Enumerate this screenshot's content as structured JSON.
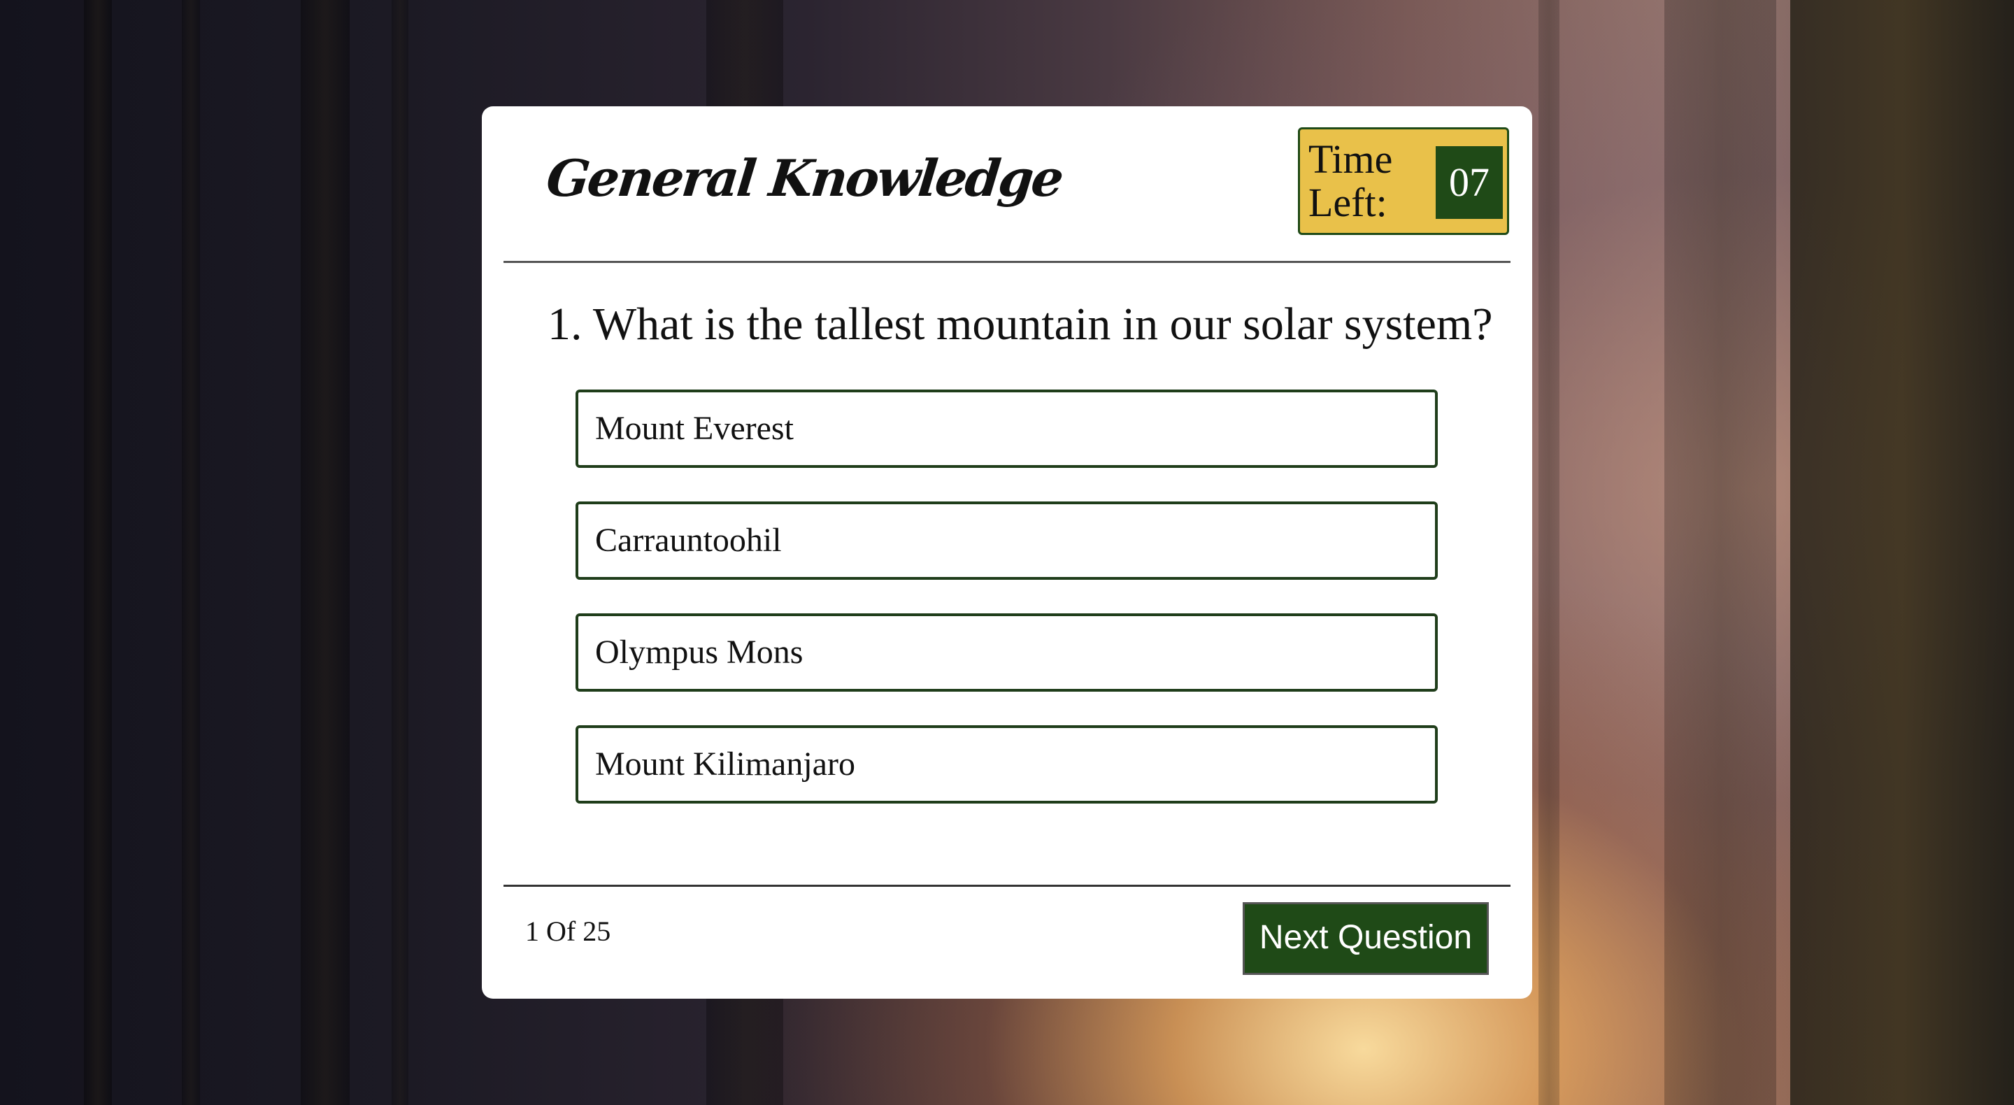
{
  "quiz": {
    "title": "General Knowledge",
    "timer": {
      "label": "Time Left:",
      "value": "07"
    },
    "question": {
      "number": "1.",
      "text": "What is the tallest mountain in our solar system?"
    },
    "options": [
      {
        "label": "Mount Everest"
      },
      {
        "label": "Carrauntoohil"
      },
      {
        "label": "Olympus Mons"
      },
      {
        "label": "Mount Kilimanjaro"
      }
    ],
    "footer": {
      "progress": "1 Of 25",
      "next_label": "Next Question"
    }
  },
  "colors": {
    "accent": "#1f4a17",
    "timer_bg": "#e9c14a",
    "card_bg": "#ffffff"
  }
}
